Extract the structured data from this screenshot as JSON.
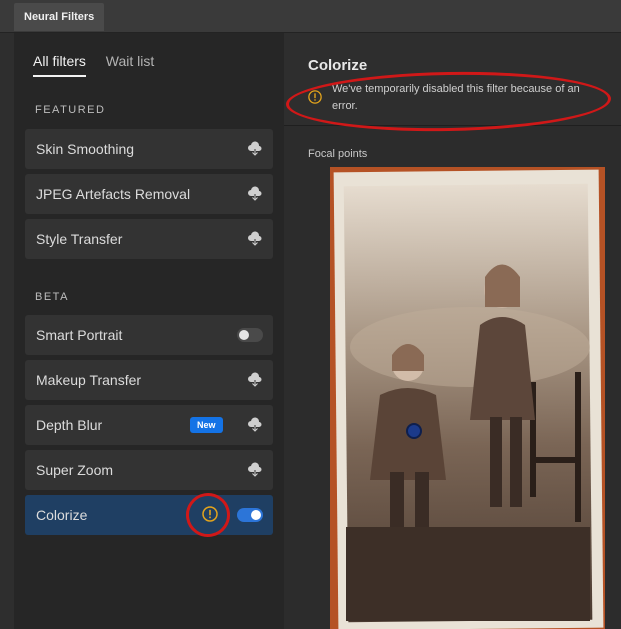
{
  "window": {
    "tab_title": "Neural Filters"
  },
  "filter_tabs": {
    "all": "All filters",
    "wait": "Wait list"
  },
  "sections": {
    "featured": "FEATURED",
    "beta": "BETA"
  },
  "featured_items": [
    {
      "label": "Skin Smoothing",
      "icon": "cloud-download-icon"
    },
    {
      "label": "JPEG Artefacts Removal",
      "icon": "cloud-download-icon"
    },
    {
      "label": "Style Transfer",
      "icon": "cloud-download-icon"
    }
  ],
  "beta_items": [
    {
      "label": "Smart Portrait",
      "control": "toggle-off"
    },
    {
      "label": "Makeup Transfer",
      "icon": "cloud-download-icon"
    },
    {
      "label": "Depth Blur",
      "badge": "New",
      "icon": "cloud-download-icon"
    },
    {
      "label": "Super Zoom",
      "icon": "cloud-download-icon"
    },
    {
      "label": "Colorize",
      "control": "toggle-on",
      "warning": true,
      "selected": true
    }
  ],
  "detail": {
    "title": "Colorize",
    "error_message": "We've temporarily disabled this filter because of an error.",
    "focal_points_label": "Focal points"
  },
  "colors": {
    "selected_item": "#1f3f63",
    "toggle_on": "#2c75d8",
    "badge": "#1473e6",
    "warning": "#e3a41c",
    "annotation_red": "#d01818"
  }
}
